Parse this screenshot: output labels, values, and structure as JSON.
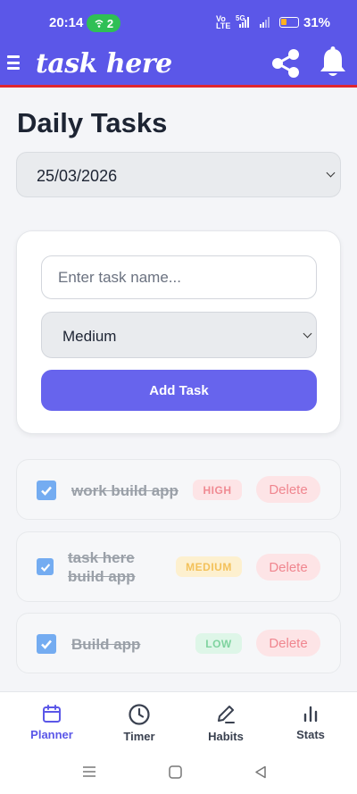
{
  "status_bar": {
    "time": "20:14",
    "hotspot_count": "2",
    "network_top": "Vo",
    "network_mid": "LTE",
    "network_5g": "5G",
    "battery": "31%"
  },
  "header": {
    "title": "task here",
    "accent": "#5b57e8"
  },
  "page": {
    "title": "Daily Tasks",
    "date_value": "25/03/2026"
  },
  "add_task": {
    "input_placeholder": "Enter task name...",
    "input_value": "",
    "priority_value": "Medium",
    "add_label": "Add Task"
  },
  "tasks": [
    {
      "name": "work build app",
      "priority": "HIGH",
      "completed": true,
      "delete_label": "Delete"
    },
    {
      "name": "task here build app",
      "priority": "MEDIUM",
      "completed": true,
      "delete_label": "Delete"
    },
    {
      "name": "Build app",
      "priority": "LOW",
      "completed": true,
      "delete_label": "Delete"
    }
  ],
  "bottom_nav": [
    {
      "label": "Planner",
      "icon": "calendar-icon",
      "active": true
    },
    {
      "label": "Timer",
      "icon": "clock-icon",
      "active": false
    },
    {
      "label": "Habits",
      "icon": "pen-icon",
      "active": false
    },
    {
      "label": "Stats",
      "icon": "bar-chart-icon",
      "active": false
    }
  ],
  "colors": {
    "primary": "#5b57e8",
    "header_underline": "#e0262f",
    "high": "#f08a92",
    "medium": "#f3c15a",
    "low": "#7fd39f"
  }
}
